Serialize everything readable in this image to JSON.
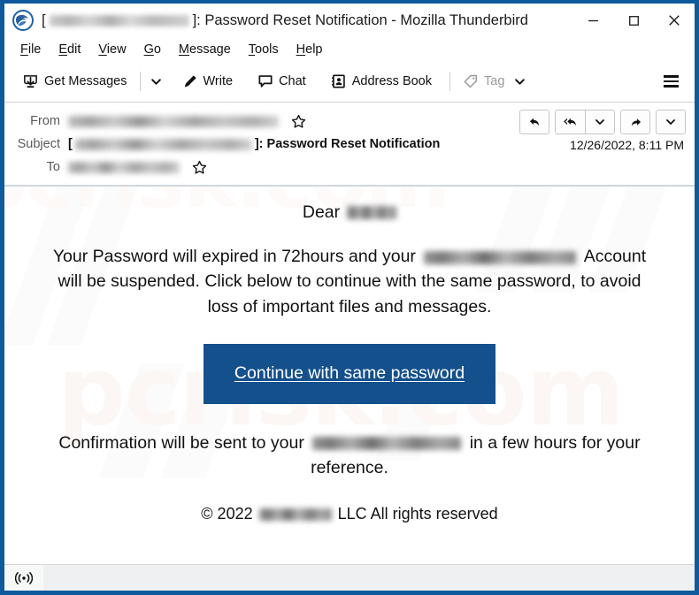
{
  "window": {
    "title_prefix": "[",
    "title_redacted": "redacted-email-address",
    "title_suffix": "]: Password Reset Notification - Mozilla Thunderbird",
    "app_icon": "thunderbird-logo-icon",
    "border_color": "#0f5a9c",
    "controls": {
      "minimize_label": "─",
      "maximize_label": "□",
      "close_label": "✕"
    }
  },
  "menubar": {
    "items": [
      {
        "label": "File",
        "accesskey": "F"
      },
      {
        "label": "Edit",
        "accesskey": "E"
      },
      {
        "label": "View",
        "accesskey": "V"
      },
      {
        "label": "Go",
        "accesskey": "G"
      },
      {
        "label": "Message",
        "accesskey": "M"
      },
      {
        "label": "Tools",
        "accesskey": "T"
      },
      {
        "label": "Help",
        "accesskey": "H"
      }
    ]
  },
  "toolbar": {
    "get_messages_label": "Get Messages",
    "get_messages_icon": "get-messages-icon",
    "get_messages_caret_icon": "chevron-down-icon",
    "write_label": "Write",
    "write_icon": "pencil-icon",
    "chat_label": "Chat",
    "chat_icon": "chat-bubble-icon",
    "address_book_label": "Address Book",
    "address_book_icon": "address-book-icon",
    "tag_label": "Tag",
    "tag_icon": "tag-icon",
    "tag_caret_icon": "chevron-down-icon",
    "tag_disabled": true,
    "app_menu_icon": "hamburger-menu-icon"
  },
  "message_header": {
    "from_label": "From",
    "from_value_redacted": "sender-name sender@redacted.com",
    "from_star_icon": "star-icon",
    "subject_label": "Subject",
    "subject_bracket_open": "[",
    "subject_redacted": "redacted@domain.com",
    "subject_text": "]: Password Reset Notification",
    "to_label": "To",
    "to_value_redacted": "recipient@redacted.com",
    "to_star_icon": "star-icon",
    "date": "12/26/2022, 8:11 PM",
    "actions": [
      {
        "name": "reply-button",
        "icon": "reply-arrow-icon"
      },
      {
        "name": "reply-all-button",
        "icon": "reply-all-arrow-icon"
      },
      {
        "name": "reply-all-dropdown",
        "icon": "chevron-down-icon"
      },
      {
        "name": "forward-button",
        "icon": "forward-arrow-icon"
      },
      {
        "name": "forward-dropdown",
        "icon": "chevron-down-icon"
      }
    ]
  },
  "message_body": {
    "greeting_text": "Dear",
    "greeting_redacted": "name",
    "paragraph_part1": "Your Password will expired  in 72hours and your",
    "paragraph_redacted": "redacted@domain.com",
    "paragraph_part2": "Account will be suspended. Click below to continue with the same password, to avoid loss of important files and messages.",
    "cta_label": "Continue with same password",
    "cta_background": "#14508C",
    "footer_part1": "Confirmation will be sent to your",
    "footer_redacted": "redacted@domain.com",
    "footer_part2": "in a few hours for your reference.",
    "copyright_part1": "© 2022",
    "copyright_redacted": "domain.com",
    "copyright_part2": "LLC All rights reserved",
    "watermark_text": "pcrisk.com"
  },
  "statusbar": {
    "connection_icon": "broadcast-connection-icon",
    "status_text": ""
  }
}
